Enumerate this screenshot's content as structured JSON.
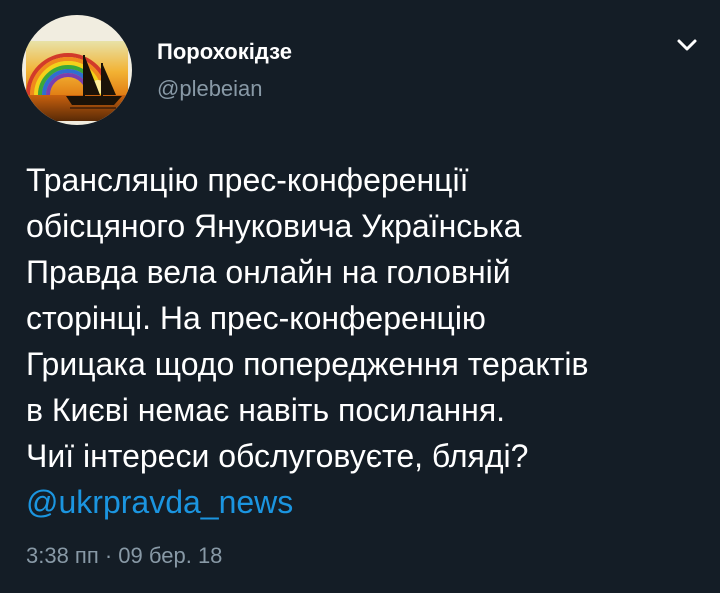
{
  "theme": {
    "background": "#141d26",
    "text": "#ffffff",
    "secondary_text": "#8899a6",
    "link": "#1b95e0"
  },
  "author": {
    "display_name": "Порохокідзе",
    "handle": "@plebeian",
    "avatar_icon": "sailboat-sunset-rainbow-avatar"
  },
  "menu": {
    "icon": "chevron-down-icon"
  },
  "tweet": {
    "lines": [
      "Трансляцію прес-конференції",
      "обісцяного Януковича Українська",
      "Правда вела онлайн на головній",
      "сторінці. На прес-конференцію",
      "Грицака щодо попередження терактів",
      "в Києві немає навіть посилання.",
      "Чиї інтереси обслуговуєте, бляді?"
    ],
    "mention": "@ukrpravda_news"
  },
  "meta": {
    "timestamp": "3:38 пп · 09 бер. 18"
  }
}
